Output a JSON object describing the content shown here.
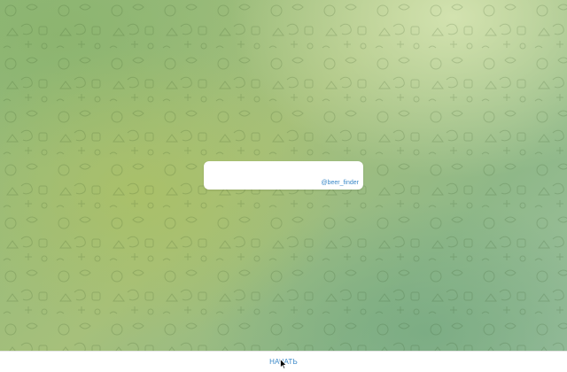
{
  "chat": {
    "bot_username": "@beer_finder"
  },
  "bottom_bar": {
    "start_label": "Начать"
  },
  "colors": {
    "accent": "#3a88c8",
    "background_green": "#a6c07b",
    "card": "#ffffff"
  },
  "icons": {
    "background_pattern": "doodle-pattern-icon",
    "cursor": "mouse-pointer-icon"
  }
}
